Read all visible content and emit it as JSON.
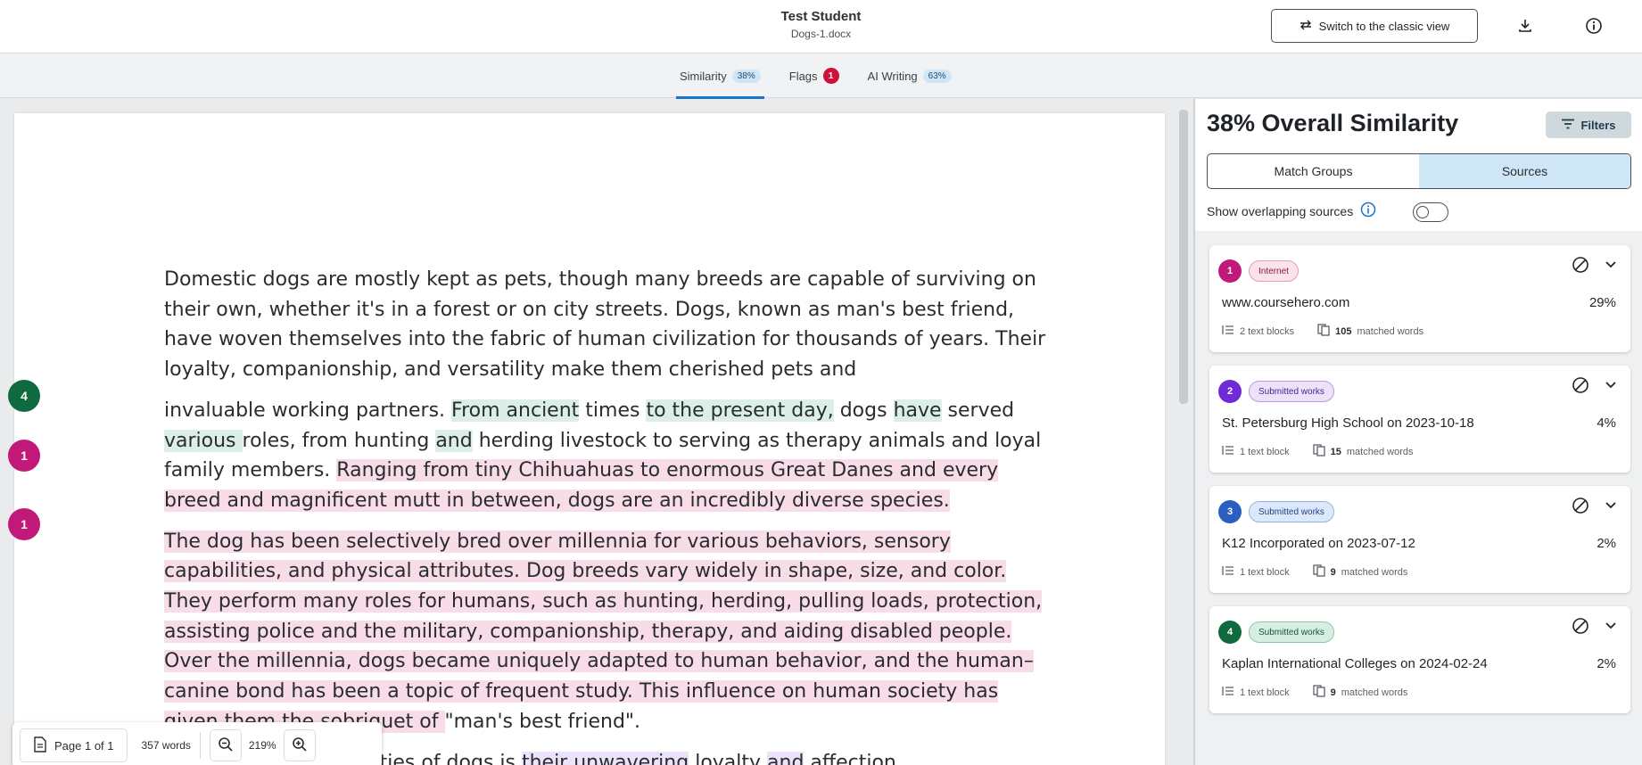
{
  "header": {
    "student_name": "Test Student",
    "file_name": "Dogs-1.docx",
    "classic_view_label": "Switch to the classic view",
    "download_icon": "download-icon",
    "info_icon": "info-icon"
  },
  "tabs": [
    {
      "label": "Similarity",
      "badge": "38%"
    },
    {
      "label": "Flags",
      "badge": "1"
    },
    {
      "label": "AI Writing",
      "badge": "63%"
    }
  ],
  "document": {
    "p1_a": "Domestic dogs are mostly kept as pets,  though many breeds are capable of surviving on their own,  whether it's in a forest or on city streets.  Dogs,  known as man's best friend, have woven themselves into the fabric of human civilization for thousands of years.  Their loyalty,  companionship, and versatility make them cherished pets and",
    "p2_a": "invaluable working partners. ",
    "p2_b": "From ancient",
    "p2_c": " times ",
    "p2_d": "to the present day,",
    "p2_e": " dogs ",
    "p2_f": "have",
    "p2_g": " served ",
    "p2_h": "various ",
    "p2_i": "roles, from hunting ",
    "p2_j": "and",
    "p2_k": " herding livestock to serving as therapy animals and loyal family members. ",
    "p2_l": "Ranging from tiny Chihuahuas to enormous Great Danes and every breed and magnificent mutt in between, dogs are an incredibly diverse species.",
    "p3_a": "The dog has been selectively bred over millennia for various behaviors, sensory capabilities, and physical attributes. Dog breeds vary widely in shape, size, and color. They perform many roles for humans, such as hunting, herding, pulling loads, protection, assisting police and the military, companionship, therapy, and aiding disabled people. Over the millennia, dogs became uniquely adapted to human behavior, and the human–canine bond has been a topic of frequent study. This influence on human society has given them the sobriquet of ",
    "p3_b": "\"man's best friend\".",
    "p4_a": "ing qualities of dogs is ",
    "p4_b": "their unwavering",
    "p4_c": " loyalty ",
    "p4_d": "and",
    "p4_e": " affection"
  },
  "markers": [
    {
      "label": "4",
      "color": "#0f6b3f"
    },
    {
      "label": "1",
      "color": "#c2187a"
    },
    {
      "label": "1",
      "color": "#c2187a"
    }
  ],
  "toolbar": {
    "page_label": "Page 1 of 1",
    "word_count": "357 words",
    "zoom": "219%"
  },
  "panel": {
    "title": "38% Overall Similarity",
    "filters_label": "Filters",
    "segments": [
      "Match Groups",
      "Sources"
    ],
    "overlap_label": "Show overlapping sources",
    "sources": [
      {
        "num": "1",
        "num_color": "#c2187a",
        "tag": "Internet",
        "tag_bg": "#fbe3ec",
        "tag_border": "#e79bb8",
        "tag_color": "#8a1a45",
        "name": "www.coursehero.com",
        "pct": "29%",
        "blocks": "2 text blocks",
        "words_num": "105",
        "words_label": "matched words"
      },
      {
        "num": "2",
        "num_color": "#6f2bd8",
        "tag": "Submitted works",
        "tag_bg": "#ece3fb",
        "tag_border": "#b79ae8",
        "tag_color": "#4a2191",
        "name": "St. Petersburg High School on 2023-10-18",
        "pct": "4%",
        "blocks": "1 text block",
        "words_num": "15",
        "words_label": "matched words"
      },
      {
        "num": "3",
        "num_color": "#2a5fc1",
        "tag": "Submitted works",
        "tag_bg": "#dde9fb",
        "tag_border": "#93b3e8",
        "tag_color": "#1e4384",
        "name": "K12 Incorporated on 2023-07-12",
        "pct": "2%",
        "blocks": "1 text block",
        "words_num": "9",
        "words_label": "matched words"
      },
      {
        "num": "4",
        "num_color": "#0f6b3f",
        "tag": "Submitted works",
        "tag_bg": "#d7efe3",
        "tag_border": "#8cc8a8",
        "tag_color": "#0f5a35",
        "name": "Kaplan International Colleges on 2024-02-24",
        "pct": "2%",
        "blocks": "1 text block",
        "words_num": "9",
        "words_label": "matched words"
      }
    ]
  }
}
